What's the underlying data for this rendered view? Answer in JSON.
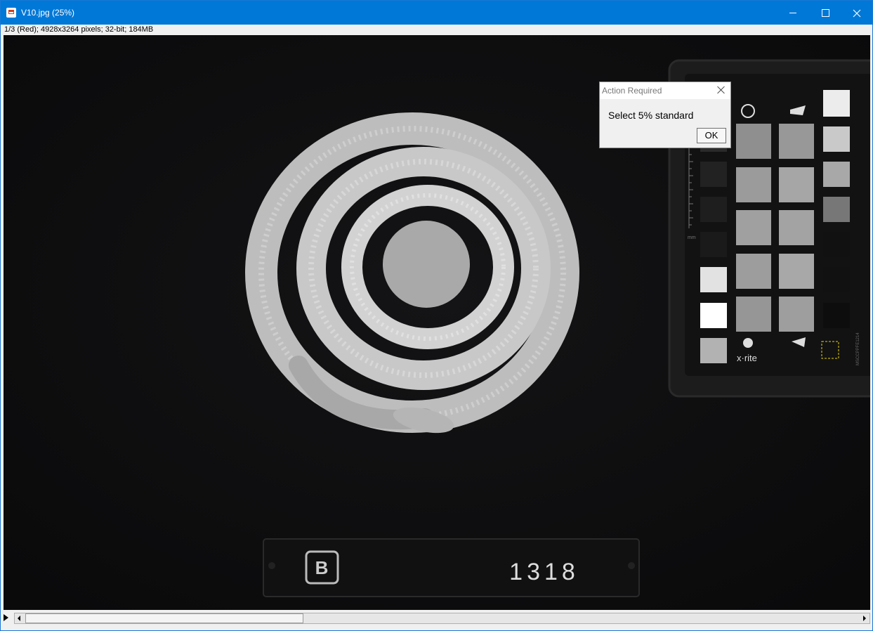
{
  "window": {
    "title": "V10.jpg (25%)",
    "status": "1/3 (Red); 4928x3264 pixels; 32-bit; 184MB"
  },
  "image": {
    "plate_number": "1318",
    "plate_logo": "B",
    "chart_brand": "x·rite",
    "chart_id": "MSCCPPFE1214",
    "ruler_unit": "mm"
  },
  "dialog": {
    "title": "Action Required",
    "message": "Select 5% standard",
    "ok_label": "OK"
  },
  "scrollbar": {
    "position": 0.05
  }
}
